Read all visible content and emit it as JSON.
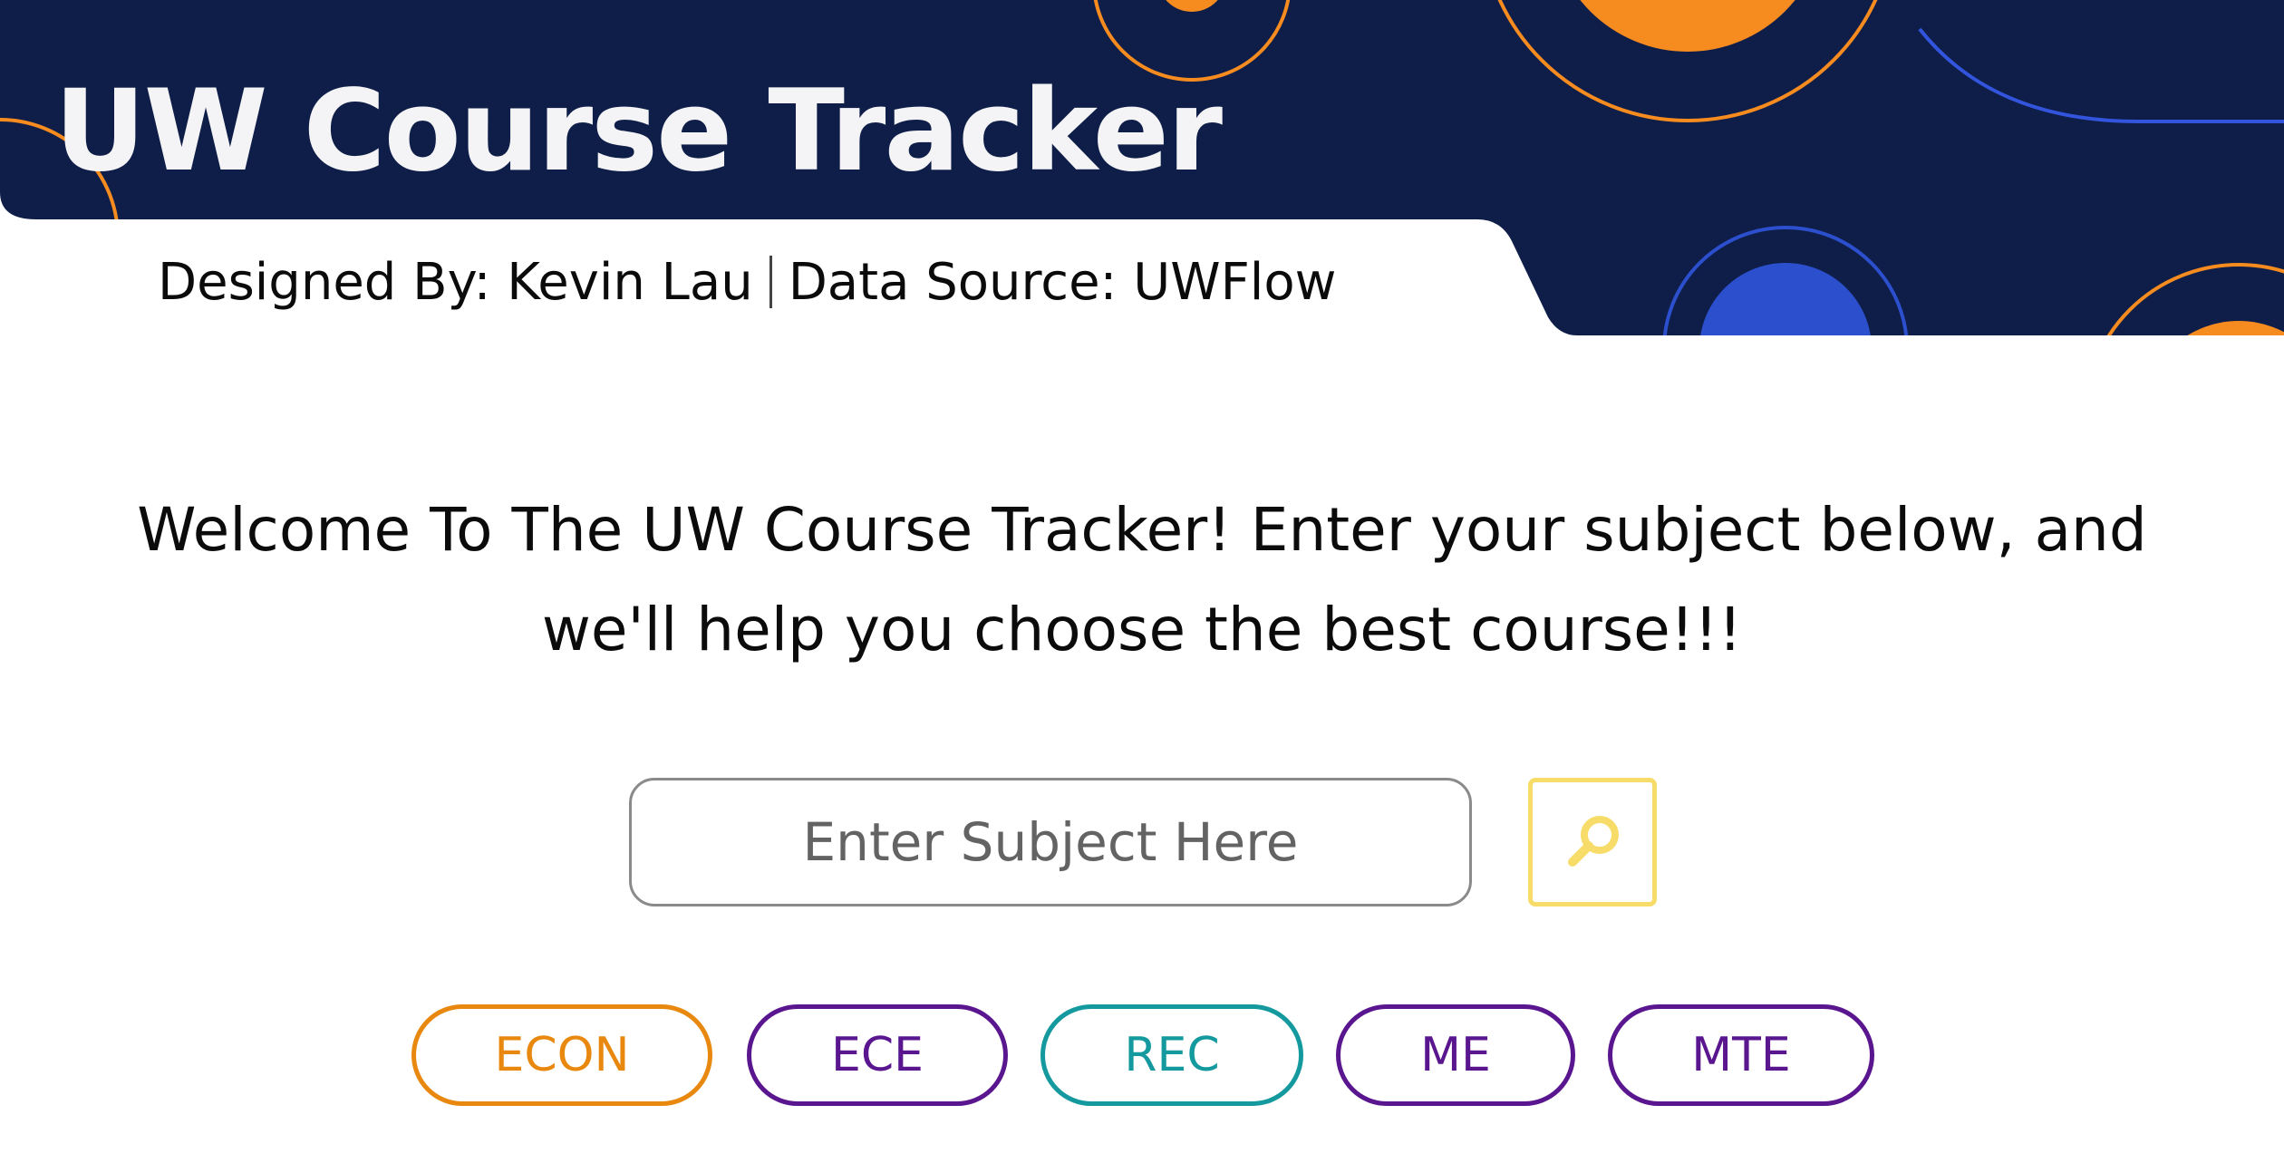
{
  "header": {
    "title": "UW Course Tracker",
    "designed_by": "Designed By: Kevin Lau",
    "data_source": "Data Source: UWFlow",
    "colors": {
      "navy": "#0e1e48",
      "orange": "#f68b1f",
      "blue": "#2c4fce"
    }
  },
  "main": {
    "welcome_line1": "Welcome To The UW Course Tracker! Enter your subject below, and",
    "welcome_line2": "we'll help you choose the best course!!!"
  },
  "search": {
    "placeholder": "Enter Subject Here",
    "value": "",
    "button_icon": "search-icon",
    "accent": "#f7dc6a"
  },
  "subjects": [
    {
      "label": "ECON",
      "color": "#e8880f"
    },
    {
      "label": "ECE",
      "color": "#5a168f"
    },
    {
      "label": "REC",
      "color": "#13999e"
    },
    {
      "label": "ME",
      "color": "#5a168f"
    },
    {
      "label": "MTE",
      "color": "#5a168f"
    }
  ]
}
